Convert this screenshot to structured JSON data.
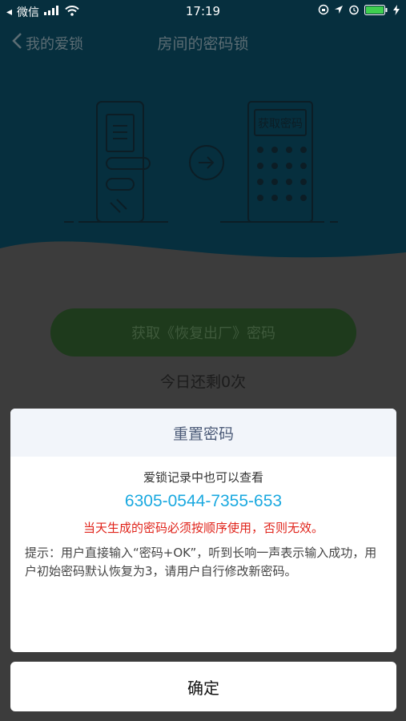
{
  "status_bar": {
    "carrier": "微信",
    "time": "17:19"
  },
  "nav": {
    "back_label": "我的爱锁",
    "title": "房间的密码锁"
  },
  "illustration": {
    "keypad_label": "获取密码"
  },
  "main": {
    "get_button_label": "获取《恢复出厂》密码",
    "remaining_text": "今日还剩0次"
  },
  "dialog": {
    "title": "重置密码",
    "subtitle": "爱锁记录中也可以查看",
    "code": "6305-0544-7355-653",
    "warning": "当天生成的密码必须按顺序使用，否则无效。",
    "tip": "提示：用户直接输入“密码+OK”，听到长响一声表示输入成功，用户初始密码默认恢复为3，请用户自行修改新密码。",
    "confirm_label": "确定"
  },
  "colors": {
    "hero_bg": "#062f3e",
    "overlay_bg": "#3c3c3c",
    "code_color": "#1aa9e0",
    "warning_color": "#e0241b",
    "dialog_header_bg": "#f2f5fa"
  }
}
